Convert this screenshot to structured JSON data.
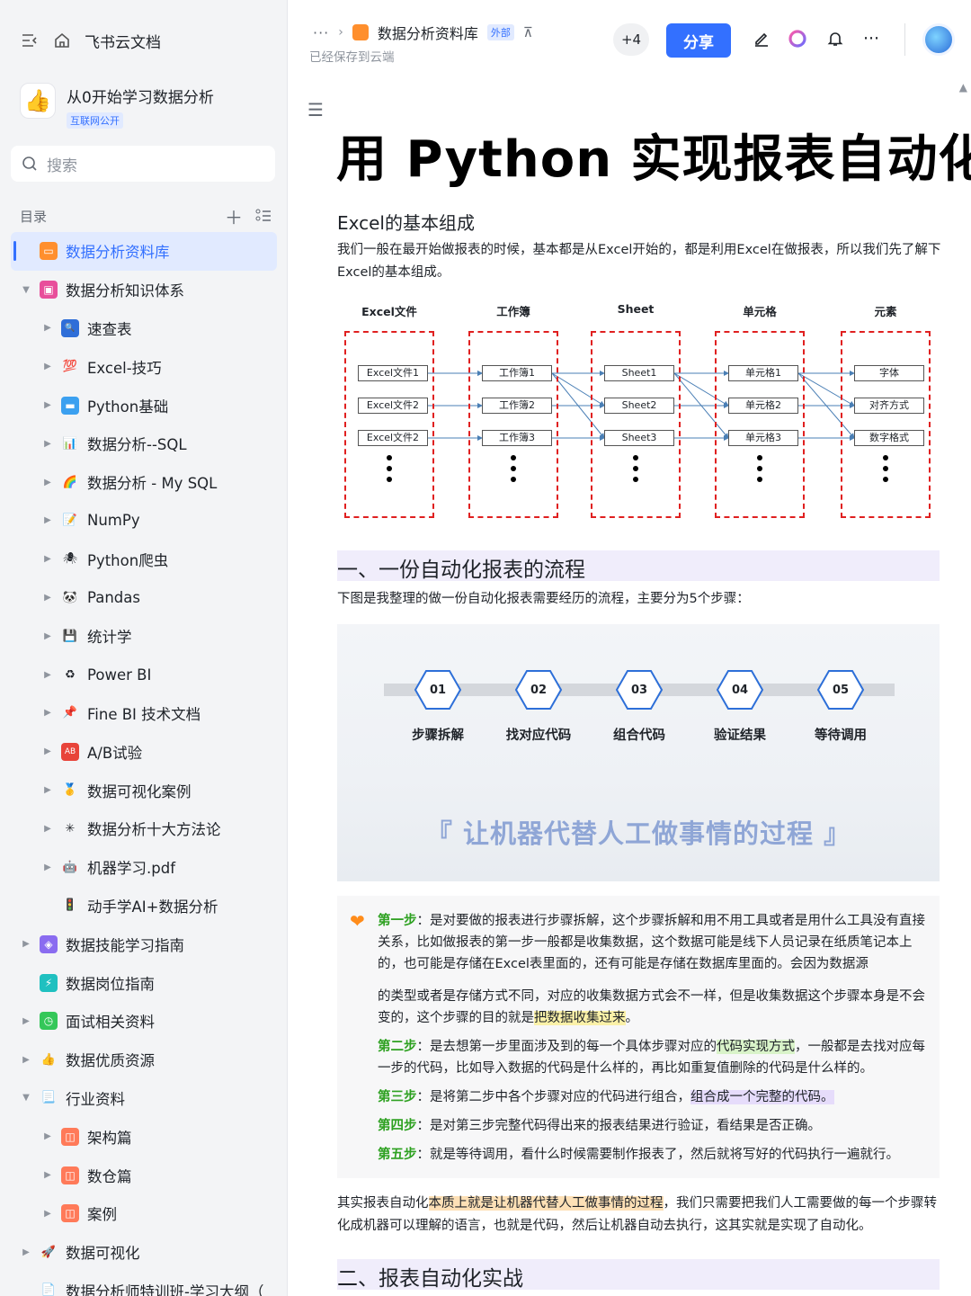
{
  "sidebar": {
    "app_name": "飞书云文档",
    "space": {
      "logo": "👍",
      "name": "从0开始学习数据分析",
      "tag": "互联网公开"
    },
    "search_placeholder": "搜索",
    "toc_label": "目录",
    "items": [
      {
        "label": "数据分析资料库",
        "icon": "folder-icon",
        "color": "#ff8f2d",
        "glyph": "▭",
        "level": 1,
        "arrow": "",
        "active": true
      },
      {
        "label": "数据分析知识体系",
        "icon": "book-icon",
        "color": "#e84f9b",
        "glyph": "▣",
        "level": 1,
        "arrow": "▼",
        "active": false
      },
      {
        "label": "速查表",
        "icon": "magnifier-icon",
        "color": "#2f6ed8",
        "glyph": "🔍",
        "level": 2,
        "arrow": "▶",
        "active": false
      },
      {
        "label": "Excel-技巧",
        "icon": "hundred-icon",
        "color": "#ffffff",
        "glyph": "💯",
        "level": 2,
        "arrow": "▶",
        "active": false
      },
      {
        "label": "Python基础",
        "icon": "screen-icon",
        "color": "#3ba0f0",
        "glyph": "▬",
        "level": 2,
        "arrow": "▶",
        "active": false
      },
      {
        "label": "数据分析--SQL",
        "icon": "bar-chart-icon",
        "color": "#ffffff",
        "glyph": "📊",
        "level": 2,
        "arrow": "▶",
        "active": false
      },
      {
        "label": "数据分析 - My SQL",
        "icon": "rainbow-icon",
        "color": "#ffffff",
        "glyph": "🌈",
        "level": 2,
        "arrow": "▶",
        "active": false
      },
      {
        "label": "NumPy",
        "icon": "memo-icon",
        "color": "#ffffff",
        "glyph": "📝",
        "level": 2,
        "arrow": "▶",
        "active": false
      },
      {
        "label": "Python爬虫",
        "icon": "spider-icon",
        "color": "#ffffff",
        "glyph": "🕷",
        "level": 2,
        "arrow": "▶",
        "active": false
      },
      {
        "label": "Pandas",
        "icon": "panda-icon",
        "color": "#ffffff",
        "glyph": "🐼",
        "level": 2,
        "arrow": "▶",
        "active": false
      },
      {
        "label": "统计学",
        "icon": "floppy-icon",
        "color": "#ffffff",
        "glyph": "💾",
        "level": 2,
        "arrow": "▶",
        "active": false
      },
      {
        "label": "Power BI",
        "icon": "recycle-icon",
        "color": "#ffffff",
        "glyph": "♻",
        "level": 2,
        "arrow": "▶",
        "active": false
      },
      {
        "label": "Fine BI 技术文档",
        "icon": "pin-icon",
        "color": "#ffffff",
        "glyph": "📌",
        "level": 2,
        "arrow": "▶",
        "active": false
      },
      {
        "label": "A/B试验",
        "icon": "ab-icon",
        "color": "#e8443a",
        "glyph": "AB",
        "level": 2,
        "arrow": "▶",
        "active": false
      },
      {
        "label": "数据可视化案例",
        "icon": "medal-icon",
        "color": "#ffffff",
        "glyph": "🥇",
        "level": 2,
        "arrow": "▶",
        "active": false
      },
      {
        "label": "数据分析十大方法论",
        "icon": "sparkle-icon",
        "color": "#ffffff",
        "glyph": "✳",
        "level": 2,
        "arrow": "▶",
        "active": false
      },
      {
        "label": "机器学习.pdf",
        "icon": "robot-icon",
        "color": "#ffffff",
        "glyph": "🤖",
        "level": 2,
        "arrow": "▶",
        "active": false
      },
      {
        "label": "动手学AI+数据分析",
        "icon": "traffic-light-icon",
        "color": "#ffffff",
        "glyph": "🚦",
        "level": 2,
        "arrow": "",
        "active": false
      },
      {
        "label": "数据技能学习指南",
        "icon": "cube-icon",
        "color": "#8a6cf0",
        "glyph": "◈",
        "level": 1,
        "arrow": "▶",
        "active": false
      },
      {
        "label": "数据岗位指南",
        "icon": "lightning-icon",
        "color": "#1fc0c0",
        "glyph": "⚡",
        "level": 1,
        "arrow": "",
        "active": false
      },
      {
        "label": "面试相关资料",
        "icon": "clock-icon",
        "color": "#34c759",
        "glyph": "◷",
        "level": 1,
        "arrow": "▶",
        "active": false
      },
      {
        "label": "数据优质资源",
        "icon": "thumbs-up-icon",
        "color": "#ffffff",
        "glyph": "👍",
        "level": 1,
        "arrow": "▶",
        "active": false
      },
      {
        "label": "行业资料",
        "icon": "doc-icon",
        "color": "#ffffff",
        "glyph": "📃",
        "level": 1,
        "arrow": "▼",
        "active": false
      },
      {
        "label": "架构篇",
        "icon": "orange-block-icon",
        "color": "#ff7a59",
        "glyph": "◫",
        "level": 2,
        "arrow": "▶",
        "active": false
      },
      {
        "label": "数仓篇",
        "icon": "orange-block-icon",
        "color": "#ff7a59",
        "glyph": "◫",
        "level": 2,
        "arrow": "▶",
        "active": false
      },
      {
        "label": "案例",
        "icon": "orange-block-icon",
        "color": "#ff7a59",
        "glyph": "◫",
        "level": 2,
        "arrow": "▶",
        "active": false
      },
      {
        "label": "数据可视化",
        "icon": "rocket-icon",
        "color": "#ffffff",
        "glyph": "🚀",
        "level": 1,
        "arrow": "▶",
        "active": false
      },
      {
        "label": "数据分析师特训班-学习大纲（",
        "icon": "doc-icon",
        "color": "#ffffff",
        "glyph": "📄",
        "level": 1,
        "arrow": "",
        "active": false
      }
    ]
  },
  "header": {
    "breadcrumb_more": "···",
    "doc_name": "数据分析资料库",
    "ext_tag": "外部",
    "saved_status": "已经保存到云端",
    "collab_count": "+4",
    "share_label": "分享"
  },
  "doc": {
    "title": "用 Python 实现报表自动化",
    "sub1": "Excel的基本组成",
    "intro": "我们一般在最开始做报表的时候，基本都是从Excel开始的，都是利用Excel在做报表，所以我们先了解下Excel的基本组成。",
    "diagram": {
      "columns": [
        {
          "head": "Excel文件",
          "cells": [
            "Excel文件1",
            "Excel文件2",
            "Excel文件2"
          ]
        },
        {
          "head": "工作簿",
          "cells": [
            "工作簿1",
            "工作簿2",
            "工作簿3"
          ]
        },
        {
          "head": "Sheet",
          "cells": [
            "Sheet1",
            "Sheet2",
            "Sheet3"
          ]
        },
        {
          "head": "单元格",
          "cells": [
            "单元格1",
            "单元格2",
            "单元格3"
          ]
        },
        {
          "head": "元素",
          "cells": [
            "字体",
            "对齐方式",
            "数字格式"
          ]
        }
      ]
    },
    "sec1_title": "一、一份自动化报表的流程",
    "sec1_intro": "下图是我整理的做一份自动化报表需要经历的流程，主要分为5个步骤：",
    "process": {
      "steps": [
        {
          "num": "01",
          "label": "步骤拆解"
        },
        {
          "num": "02",
          "label": "找对应代码"
        },
        {
          "num": "03",
          "label": "组合代码"
        },
        {
          "num": "04",
          "label": "验证结果"
        },
        {
          "num": "05",
          "label": "等待调用"
        }
      ],
      "slogan": "『 让机器代替人工做事情的过程 』"
    },
    "steps_detail": {
      "s1_head": "第一步",
      "s1_a": "：是对要做的报表进行步骤拆解，这个步骤拆解和用不用工具或者是用什么工具没有直接关系，比如做报表的第一步一般都是收集数据，这个数据可能是线下人员记录在纸质笔记本上的，也可能是存储在Excel表里面的，还有可能是存储在数据库里面的。会因为数据源",
      "s1_b": "的类型或者是存储方式不同，对应的收集数据方式会不一样，但是收集数据这个步骤本身是不会变的，这个步骤的目的就是",
      "s1_hl": "把数据收集过来",
      "s1_end": "。",
      "s2_head": "第二步",
      "s2_a": "：是去想第一步里面涉及到的每一个具体步骤对应的",
      "s2_hl": "代码实现方式",
      "s2_b": "，一般都是去找对应每一步的代码，比如导入数据的代码是什么样的，再比如重复值删除的代码是什么样的。",
      "s3_head": "第三步",
      "s3_a": "：是将第二步中各个步骤对应的代码进行组合，",
      "s3_hl": "组合成一个完整的代码。",
      "s4_head": "第四步",
      "s4_a": "：是对第三步完整代码得出来的报表结果进行验证，看结果是否正确。",
      "s5_head": "第五步",
      "s5_a": "：就是等待调用，看什么时候需要制作报表了，然后就将写好的代码执行一遍就行。"
    },
    "summary_a": "其实报表自动化",
    "summary_hl": "本质上就是让机器代替人工做事情的过程",
    "summary_b": "，我们只需要把我们人工需要做的每一个步骤转化成机器可以理解的语言，也就是代码，然后让机器自动去执行，这其实就是实现了自动化。",
    "sec2_title": "二、报表自动化实战"
  }
}
